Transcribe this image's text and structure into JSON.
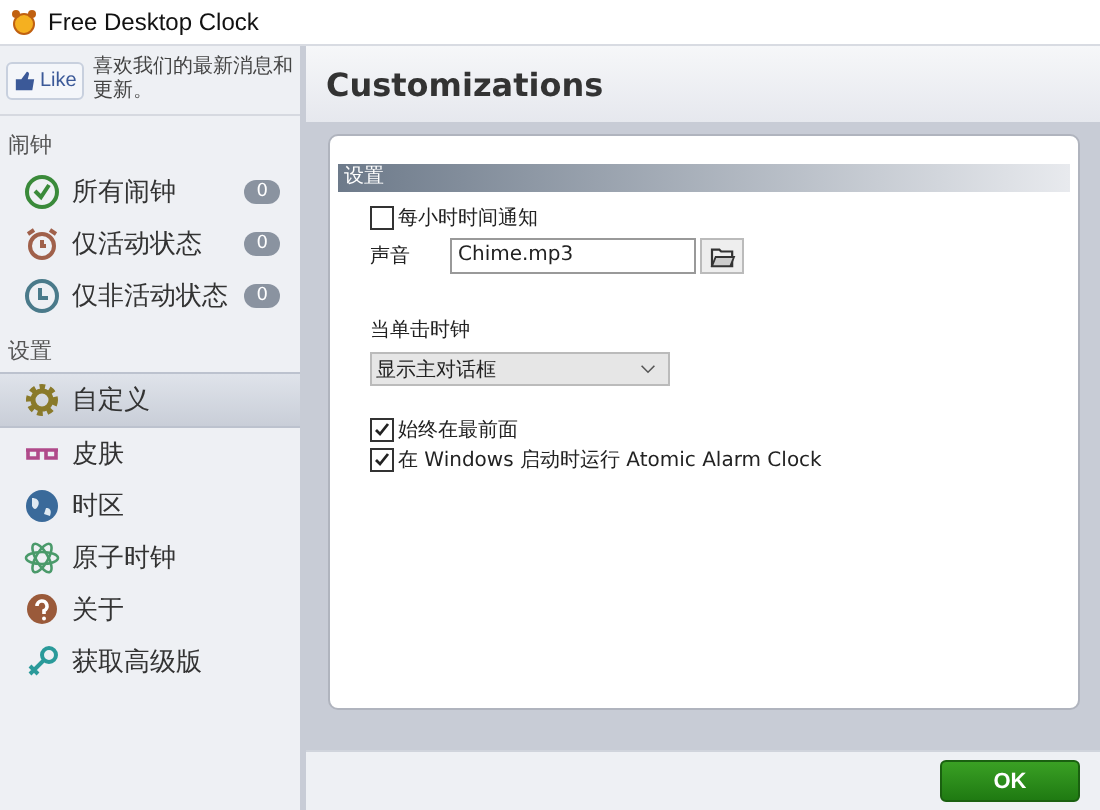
{
  "window": {
    "title": "Free Desktop Clock"
  },
  "sidebar": {
    "like_button": {
      "label": "Like"
    },
    "like_text": "喜欢我们的最新消息和更新。",
    "sections": [
      {
        "title": "闹钟",
        "items": [
          {
            "label": "所有闹钟",
            "kind": "clock-check",
            "count": "0",
            "selected": false
          },
          {
            "label": "仅活动状态",
            "kind": "alarm",
            "count": "0",
            "selected": false
          },
          {
            "label": "仅非活动状态",
            "kind": "clock",
            "count": "0",
            "selected": false
          }
        ]
      },
      {
        "title": "设置",
        "items": [
          {
            "label": "自定义",
            "kind": "gear",
            "selected": true
          },
          {
            "label": "皮肤",
            "kind": "glasses",
            "selected": false
          },
          {
            "label": "时区",
            "kind": "globe",
            "selected": false
          },
          {
            "label": "原子时钟",
            "kind": "atom",
            "selected": false
          },
          {
            "label": "关于",
            "kind": "question",
            "selected": false
          },
          {
            "label": "获取高级版",
            "kind": "key",
            "selected": false
          }
        ]
      }
    ]
  },
  "page": {
    "title": "Customizations",
    "group_title": "设置",
    "hourly_notify": {
      "label": "每小时时间通知",
      "checked": false
    },
    "sound": {
      "label": "声音",
      "value": "Chime.mp3"
    },
    "click_action": {
      "label": "当单击时钟",
      "value": "显示主对话框"
    },
    "always_on_top": {
      "label": "始终在最前面",
      "checked": true
    },
    "run_at_startup": {
      "label": "在 Windows 启动时运行 Atomic Alarm Clock",
      "checked": true
    }
  },
  "buttons": [
    {
      "label": "OK"
    }
  ]
}
